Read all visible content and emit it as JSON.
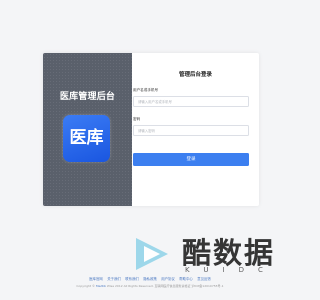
{
  "left_panel": {
    "title": "医库管理后台",
    "logo_text": "医库"
  },
  "login_form": {
    "title": "管理后台登录",
    "username_label": "用户名或手机号",
    "username_placeholder": "请输入用户名或手机号",
    "password_label": "密码",
    "password_placeholder": "请输入密码",
    "submit_label": "登录"
  },
  "footer": {
    "links": [
      "医库官网",
      "关于我们",
      "联系我们",
      "隐私政策",
      "用户协议",
      "帮助中心",
      "意见反馈"
    ],
    "copyright_prefix": "Copyright ©",
    "copyright_brand": "Medlib",
    "copyright_rest": "Wise 2012 All Rights Reserved. 互联网医疗信息服务资格证 沪ICP备12010755号-1"
  },
  "watermark": {
    "text": "酷数据",
    "sub": "KUIDC"
  },
  "colors": {
    "accent": "#3c7ff0",
    "left_panel_bg": "#5a606b",
    "logo_bg": "#1a56e0"
  },
  "icons": {
    "watermark_play": "play-triangle-icon"
  }
}
